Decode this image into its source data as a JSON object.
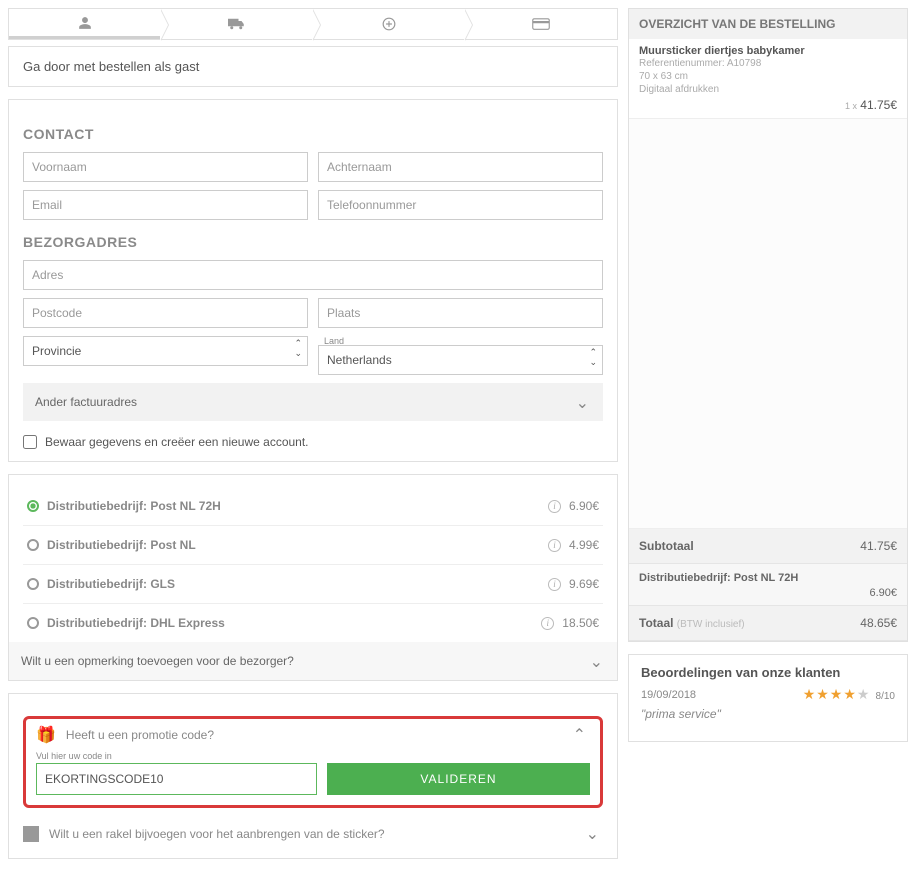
{
  "guest_message": "Ga door met bestellen als gast",
  "contact": {
    "title": "CONTACT",
    "firstname_ph": "Voornaam",
    "lastname_ph": "Achternaam",
    "email_ph": "Email",
    "phone_ph": "Telefoonnummer"
  },
  "delivery": {
    "title": "BEZORGADRES",
    "address_ph": "Adres",
    "postcode_ph": "Postcode",
    "city_ph": "Plaats",
    "province_ph": "Provincie",
    "country_label": "Land",
    "country_value": "Netherlands",
    "other_billing": "Ander factuuradres",
    "save_account": "Bewaar gegevens en creëer een nieuwe account."
  },
  "shipping": [
    {
      "label": "Distributiebedrijf: Post NL 72H",
      "price": "6.90€",
      "selected": true
    },
    {
      "label": "Distributiebedrijf: Post NL",
      "price": "4.99€",
      "selected": false
    },
    {
      "label": "Distributiebedrijf: GLS",
      "price": "9.69€",
      "selected": false
    },
    {
      "label": "Distributiebedrijf: DHL Express",
      "price": "18.50€",
      "selected": false
    }
  ],
  "carrier_comment": "Wilt u een opmerking toevoegen voor de bezorger?",
  "promo": {
    "question": "Heeft u een promotie code?",
    "hint": "Vul hier uw code in",
    "value": "EKORTINGSCODE10",
    "validate": "VALIDEREN"
  },
  "rakel_question": "Wilt u een rakel bijvoegen voor het aanbrengen van de sticker?",
  "summary": {
    "title": "OVERZICHT VAN DE BESTELLING",
    "item_name": "Muursticker diertjes babykamer",
    "item_ref": "Referentienummer: A10798",
    "item_dim": "70 x 63 cm",
    "item_print": "Digitaal afdrukken",
    "item_qty": "1 x",
    "item_price": "41.75€",
    "subtotal_label": "Subtotaal",
    "subtotal_value": "41.75€",
    "shipping_label": "Distributiebedrijf: Post NL 72H",
    "shipping_value": "6.90€",
    "total_label": "Totaal",
    "total_note": "(BTW inclusief)",
    "total_value": "48.65€"
  },
  "reviews": {
    "title": "Beoordelingen van onze klanten",
    "date": "19/09/2018",
    "score": "8/10",
    "text": "\"prima service\""
  }
}
